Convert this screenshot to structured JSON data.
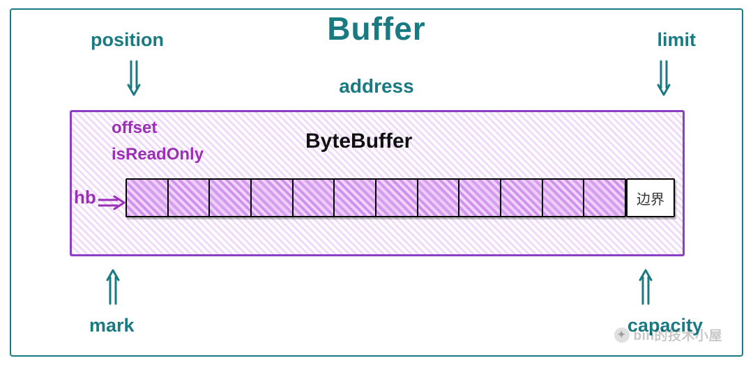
{
  "outer": {
    "title": "Buffer",
    "labels": {
      "position": "position",
      "limit": "limit",
      "address": "address",
      "mark": "mark",
      "capacity": "capacity"
    }
  },
  "inner": {
    "title": "ByteBuffer",
    "labels": {
      "offset": "offset",
      "isReadOnly": "isReadOnly",
      "hb": "hb",
      "boundary": "边界"
    },
    "cell_count": 12
  },
  "colors": {
    "teal": "#1a7a82",
    "purple": "#9b2fb5",
    "purple_border": "#8b3fc7"
  },
  "watermark": "bin的技术小屋",
  "chart_data": {
    "type": "diagram",
    "title": "Buffer / ByteBuffer structure",
    "description": "Conceptual diagram of java.nio Buffer and ByteBuffer fields. Outer Buffer shows position, limit, mark, capacity, address attributes with arrows pointing to an inner ByteBuffer block. ByteBuffer shows offset, isReadOnly, and hb (backing byte array) drawn as 12 cells, with a trailing '边界' (boundary) cell outside the array.",
    "outer_class": "Buffer",
    "outer_fields": [
      "position",
      "limit",
      "mark",
      "capacity",
      "address"
    ],
    "inner_class": "ByteBuffer",
    "inner_fields": [
      "offset",
      "isReadOnly",
      "hb"
    ],
    "hb_cells_drawn": 12,
    "boundary_label": "边界",
    "arrows": [
      {
        "from": "position",
        "direction": "down",
        "to": "ByteBuffer-left"
      },
      {
        "from": "limit",
        "direction": "down",
        "to": "ByteBuffer-right"
      },
      {
        "from": "mark",
        "direction": "up",
        "to": "ByteBuffer-left"
      },
      {
        "from": "capacity",
        "direction": "up",
        "to": "ByteBuffer-right"
      },
      {
        "from": "hb",
        "direction": "right",
        "to": "cells"
      }
    ]
  }
}
